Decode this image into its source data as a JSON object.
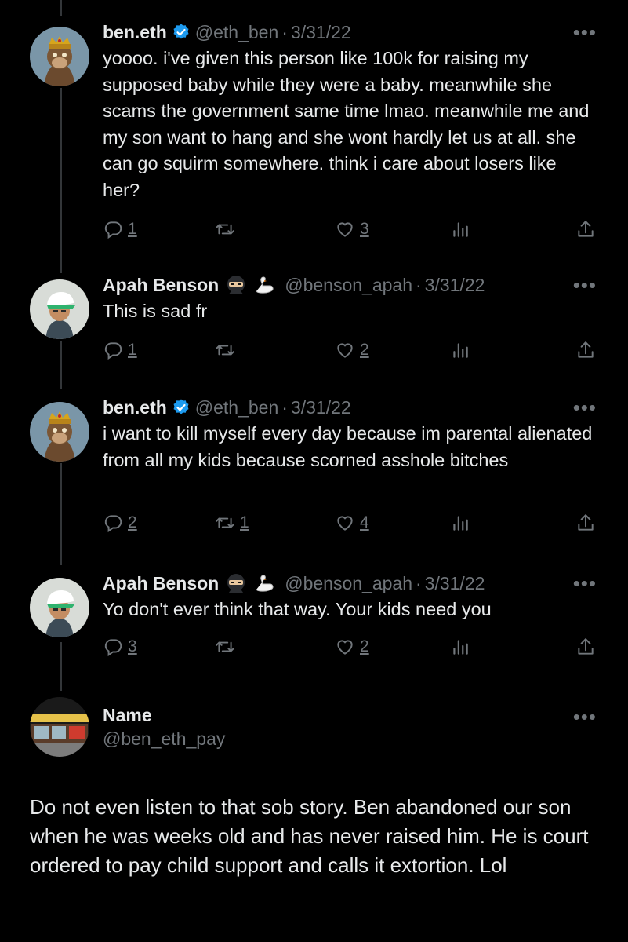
{
  "tweets": [
    {
      "name": "ben.eth",
      "handle": "@eth_ben",
      "sep": "·",
      "date": "3/31/22",
      "text": "yoooo. i've given this person like 100k for raising my supposed baby while they were a baby. meanwhile she scams the government same time lmao. meanwhile me and my son want to hang and she wont hardly let us at all. she can go squirm somewhere. think i care about losers like her?",
      "replies": "1",
      "retweets": "",
      "likes": "3"
    },
    {
      "name": "Apah Benson",
      "handle": "@benson_apah",
      "sep": "·",
      "date": "3/31/22",
      "text": "This is sad fr",
      "replies": "1",
      "retweets": "",
      "likes": "2"
    },
    {
      "name": "ben.eth",
      "handle": "@eth_ben",
      "sep": "·",
      "date": "3/31/22",
      "text": "i want to kill myself every day because im parental alienated from all my kids because scorned asshole bitches",
      "replies": "2",
      "retweets": "1",
      "likes": "4"
    },
    {
      "name": "Apah Benson",
      "handle": "@benson_apah",
      "sep": "·",
      "date": "3/31/22",
      "text": "Yo don't ever think that way. Your kids need you",
      "replies": "3",
      "retweets": "",
      "likes": "2"
    }
  ],
  "reply": {
    "name": "Name",
    "handle": "@ben_eth_pay",
    "text": "Do not even listen to that sob story. Ben abandoned our son when he was weeks old and has never raised him. He is court ordered to pay child support and calls it extortion. Lol"
  },
  "ui": {
    "more": "•••"
  },
  "colors": {
    "background": "#000000",
    "text": "#e7e9ea",
    "muted": "#71767b",
    "verified": "#1d9bf0",
    "thread_line": "#333639"
  }
}
